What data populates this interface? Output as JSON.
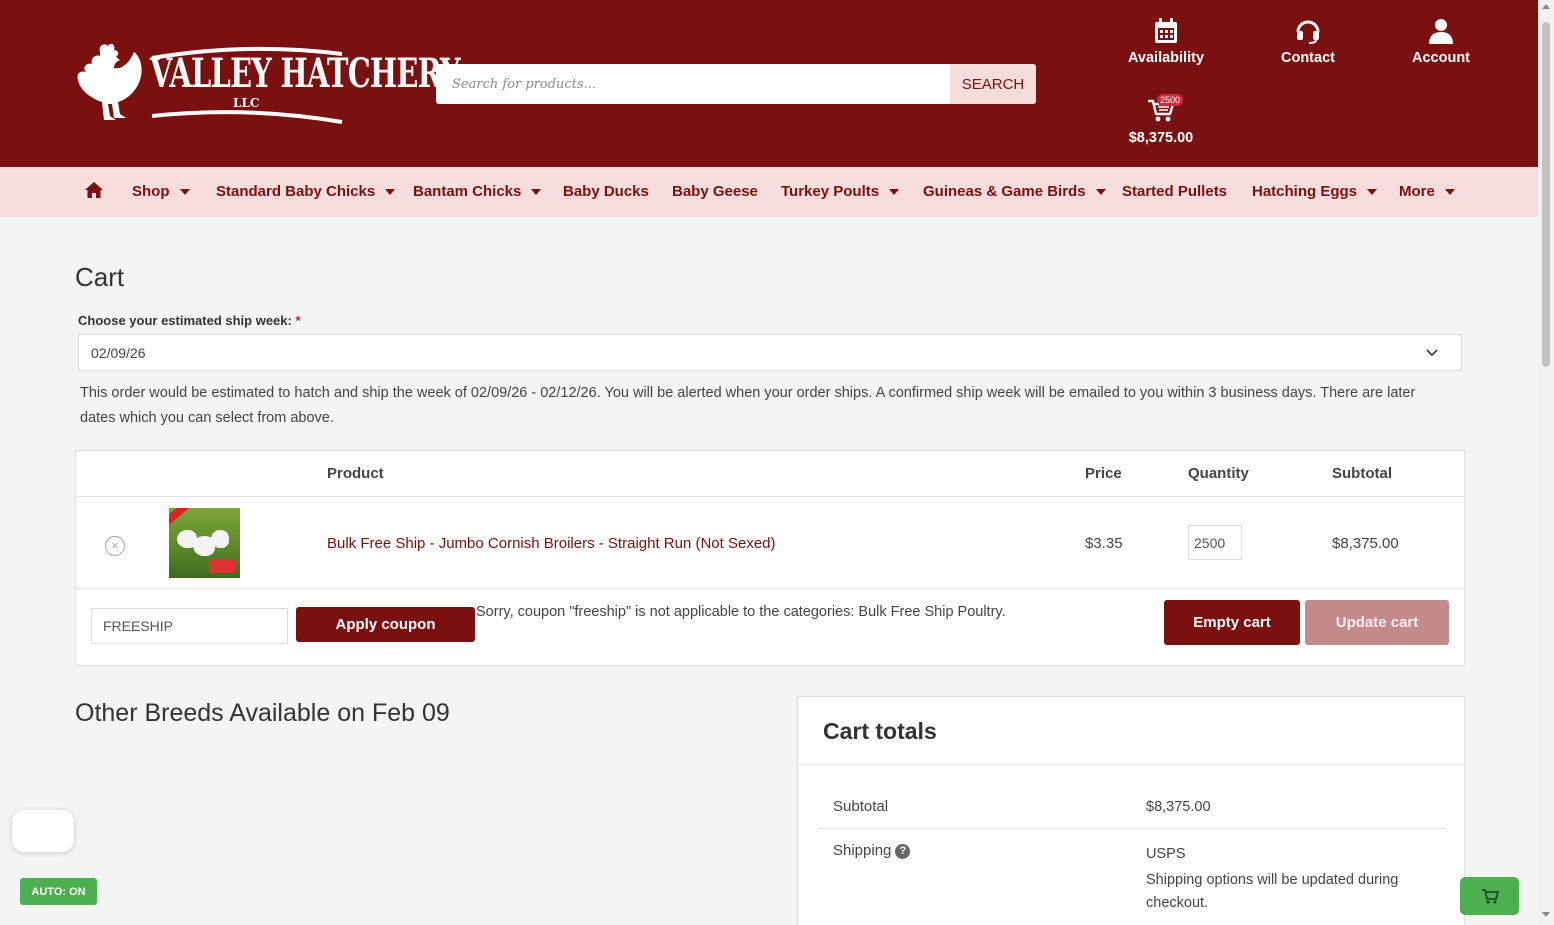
{
  "brand": {
    "name": "VALLEY HATCHERY",
    "suffix": "LLC",
    "colors": {
      "primary": "#7a1010",
      "nav_bg": "#f9dcdc",
      "accent_green": "#4caf50"
    }
  },
  "search": {
    "placeholder": "Search for products...",
    "button_label": "SEARCH"
  },
  "header_links": {
    "availability": "Availability",
    "contact": "Contact",
    "account": "Account",
    "cart_total": "$8,375.00",
    "cart_count": "2500"
  },
  "nav": {
    "home_icon": "home-icon",
    "items": [
      {
        "label": "Shop",
        "dropdown": true
      },
      {
        "label": "Standard Baby Chicks",
        "dropdown": true
      },
      {
        "label": "Bantam Chicks",
        "dropdown": true
      },
      {
        "label": "Baby Ducks",
        "dropdown": false
      },
      {
        "label": "Baby Geese",
        "dropdown": false
      },
      {
        "label": "Turkey Poults",
        "dropdown": true
      },
      {
        "label": "Guineas & Game Birds",
        "dropdown": true
      },
      {
        "label": "Started Pullets",
        "dropdown": false
      },
      {
        "label": "Hatching Eggs",
        "dropdown": true
      },
      {
        "label": "More",
        "dropdown": true
      }
    ]
  },
  "cart": {
    "title": "Cart",
    "ship_week_label": "Choose your estimated ship week:",
    "required_mark": "*",
    "ship_week_value": "02/09/26",
    "ship_note": "This order would be estimated to hatch and ship the week of 02/09/26 - 02/12/26. You will be alerted when your order ships. A confirmed ship week will be emailed to you within 3 business days. There are later dates which you can select from above.",
    "columns": {
      "product": "Product",
      "price": "Price",
      "quantity": "Quantity",
      "subtotal": "Subtotal"
    },
    "item": {
      "name": "Bulk Free Ship - Jumbo Cornish Broilers - Straight Run (Not Sexed)",
      "price": "$3.35",
      "quantity": "2500",
      "subtotal": "$8,375.00"
    },
    "coupon": {
      "value": "FREESHIP",
      "apply_label": "Apply coupon",
      "message": "Sorry, coupon \"freeship\" is not applicable to the categories: Bulk Free Ship Poultry."
    },
    "empty_label": "Empty cart",
    "update_label": "Update cart"
  },
  "other_breeds_title": "Other Breeds Available on Feb 09",
  "totals": {
    "title": "Cart totals",
    "subtotal_label": "Subtotal",
    "subtotal_value": "$8,375.00",
    "shipping_label": "Shipping",
    "shipping_method": "USPS",
    "shipping_note": "Shipping options will be updated during checkout."
  },
  "widgets": {
    "auto_label": "AUTO: ON"
  }
}
